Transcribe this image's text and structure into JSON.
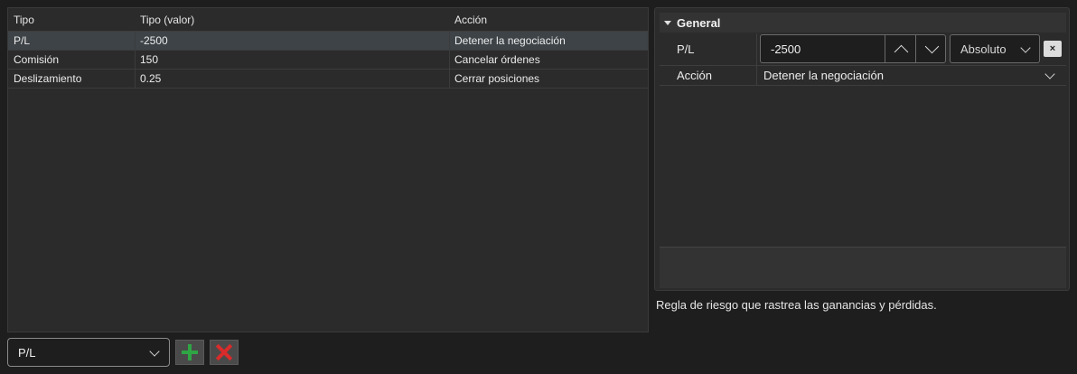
{
  "grid": {
    "columns": [
      "Tipo",
      "Tipo (valor)",
      "Acción"
    ],
    "rows": [
      {
        "tipo": "P/L",
        "valor": "-2500",
        "accion": "Detener la negociación"
      },
      {
        "tipo": "Comisión",
        "valor": "150",
        "accion": "Cancelar órdenes"
      },
      {
        "tipo": "Deslizamiento",
        "valor": "0.25",
        "accion": "Cerrar posiciones"
      }
    ],
    "selected_row": 0
  },
  "bottom": {
    "type_select": "P/L"
  },
  "panel": {
    "section": "General",
    "pl_label": "P/L",
    "pl_value": "-2500",
    "pl_mode": "Absoluto",
    "clear_label": "×",
    "action_label": "Acción",
    "action_value": "Detener la negociación"
  },
  "description": "Regla de riesgo que rastrea las ganancias y pérdidas.",
  "icons": {
    "add": "plus-icon",
    "delete": "x-icon",
    "expand": "triangle-down-icon",
    "dropdown": "chevron-down-icon",
    "spin_up": "chevron-up-icon",
    "spin_down": "chevron-down-icon"
  },
  "colors": {
    "background": "#1e1e1e",
    "panel": "#2b2b2b",
    "selected_row": "#3d4347",
    "add_green": "#2fa544",
    "delete_red": "#d92b2b"
  }
}
